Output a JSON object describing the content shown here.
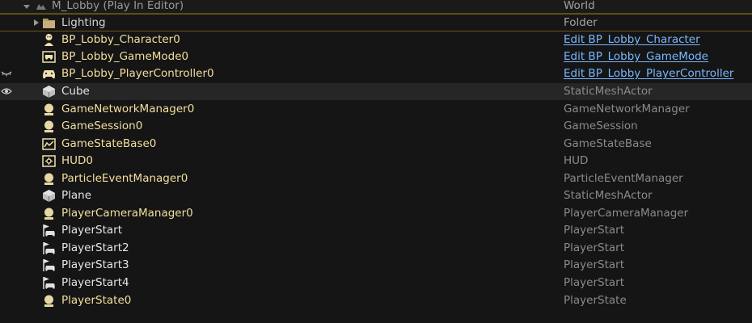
{
  "world_row": {
    "name": "M_Lobby (Play In Editor)",
    "type": "World"
  },
  "rows": [
    {
      "label": "Lighting",
      "type": "Folder",
      "icon": "folder-icon"
    },
    {
      "label": "BP_Lobby_Character0",
      "type": "Edit BP_Lobby_Character",
      "icon": "character-icon"
    },
    {
      "label": "BP_Lobby_GameMode0",
      "type": "Edit BP_Lobby_GameMode",
      "icon": "gamemode-icon"
    },
    {
      "label": "BP_Lobby_PlayerController0",
      "type": "Edit BP_Lobby_PlayerController",
      "icon": "gamepad-icon"
    },
    {
      "label": "Cube",
      "type": "StaticMeshActor",
      "icon": "static-mesh-icon"
    },
    {
      "label": "GameNetworkManager0",
      "type": "GameNetworkManager",
      "icon": "actor-pawn-icon"
    },
    {
      "label": "GameSession0",
      "type": "GameSession",
      "icon": "actor-pawn-icon"
    },
    {
      "label": "GameStateBase0",
      "type": "GameStateBase",
      "icon": "game-state-icon"
    },
    {
      "label": "HUD0",
      "type": "HUD",
      "icon": "hud-icon"
    },
    {
      "label": "ParticleEventManager0",
      "type": "ParticleEventManager",
      "icon": "actor-pawn-icon"
    },
    {
      "label": "Plane",
      "type": "StaticMeshActor",
      "icon": "static-mesh-icon"
    },
    {
      "label": "PlayerCameraManager0",
      "type": "PlayerCameraManager",
      "icon": "actor-pawn-icon"
    },
    {
      "label": "PlayerStart",
      "type": "PlayerStart",
      "icon": "player-start-icon"
    },
    {
      "label": "PlayerStart2",
      "type": "PlayerStart",
      "icon": "player-start-icon"
    },
    {
      "label": "PlayerStart3",
      "type": "PlayerStart",
      "icon": "player-start-icon"
    },
    {
      "label": "PlayerStart4",
      "type": "PlayerStart",
      "icon": "player-start-icon"
    },
    {
      "label": "PlayerState0",
      "type": "PlayerState",
      "icon": "actor-pawn-icon"
    }
  ],
  "colors": {
    "actor_label": "#f3df9e",
    "link": "#79b7ff",
    "type_text": "#8a8a8a",
    "selection_border": "#6a5417"
  }
}
